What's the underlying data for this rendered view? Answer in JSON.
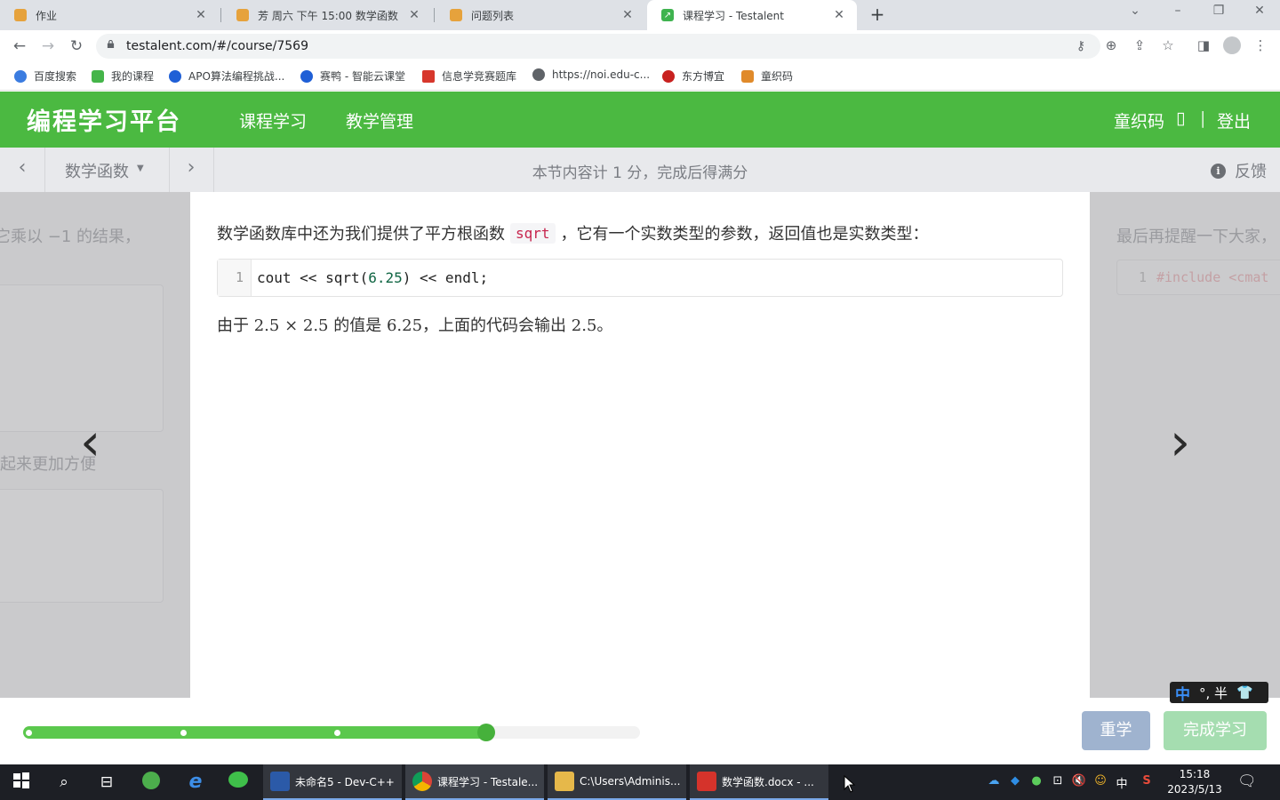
{
  "browser": {
    "tabs": [
      {
        "title": "作业",
        "icon": "user-favicon",
        "active": false
      },
      {
        "title": "芳 周六 下午 15:00 数学函数",
        "icon": "user-favicon",
        "active": false
      },
      {
        "title": "问题列表",
        "icon": "user-favicon",
        "active": false
      },
      {
        "title": "课程学习 - Testalent",
        "icon": "testalent-favicon",
        "active": true
      }
    ],
    "new_tab": "+",
    "url": "testalent.com/#/course/7569",
    "bookmarks": [
      {
        "label": "百度搜索",
        "color": "#3b7ce0"
      },
      {
        "label": "我的课程",
        "color": "#44b549"
      },
      {
        "label": "APO算法编程挑战...",
        "color": "#1f5fd6"
      },
      {
        "label": "赛鸭 - 智能云课堂",
        "color": "#1f5fd6"
      },
      {
        "label": "信息学竞赛题库",
        "color": "#d7372c"
      },
      {
        "label": "https://noi.edu-c...",
        "color": "#5f6368"
      },
      {
        "label": "东方博宜",
        "color": "#c8211f"
      },
      {
        "label": "童织码",
        "color": "#e08a2a"
      }
    ]
  },
  "site": {
    "logo": "编程学习平台",
    "nav": [
      "课程学习",
      "教学管理"
    ],
    "user": "童织码",
    "user_icon": "▯",
    "divider": "|",
    "logout": "登出",
    "brand_color": "#4bb941"
  },
  "coursebar": {
    "lesson": "数学函数",
    "info": "本节内容计 1 分，完成后得满分",
    "feedback": "反馈"
  },
  "content": {
    "para1_before": "数学函数库中还为我们提供了平方根函数",
    "inline_code": "sqrt",
    "para1_after": "，它有一个实数类型的参数，返回值也是实数类型：",
    "code_line_no": "1",
    "code_pre": "cout << sqrt(",
    "code_num": "6.25",
    "code_post": ") << endl;",
    "para2_a": "由于 ",
    "para2_math1": "2.5 × 2.5",
    "para2_b": " 的值是 ",
    "para2_math2": "6.25",
    "para2_c": "，上面的代码会输出 ",
    "para2_math3": "2.5",
    "para2_d": "。"
  },
  "ghost_left": {
    "text1": "它乘以 −1 的结果，",
    "text2": "起来更加方便"
  },
  "ghost_right": {
    "text1": "最后再提醒一下大家，",
    "line_no": "1",
    "code": "#include <cmat"
  },
  "progress": {
    "value_fraction": 0.75,
    "dots": [
      0.0,
      0.25,
      0.5
    ]
  },
  "buttons": {
    "relearn": "重学",
    "complete": "完成学习"
  },
  "ime": {
    "mode": "中",
    "rest": "°, 半"
  },
  "taskbar": {
    "apps": [
      {
        "label": "未命名5 - Dev-C++",
        "color": "#2b5aa8"
      },
      {
        "label": "课程学习 - Testale...",
        "color": "#e8a317"
      },
      {
        "label": "C:\\Users\\Adminis...",
        "color": "#e6b84a"
      },
      {
        "label": "数学函数.docx - ...",
        "color": "#d5332b"
      }
    ],
    "tray_lang": "中",
    "time": "15:18",
    "date": "2023/5/13"
  }
}
